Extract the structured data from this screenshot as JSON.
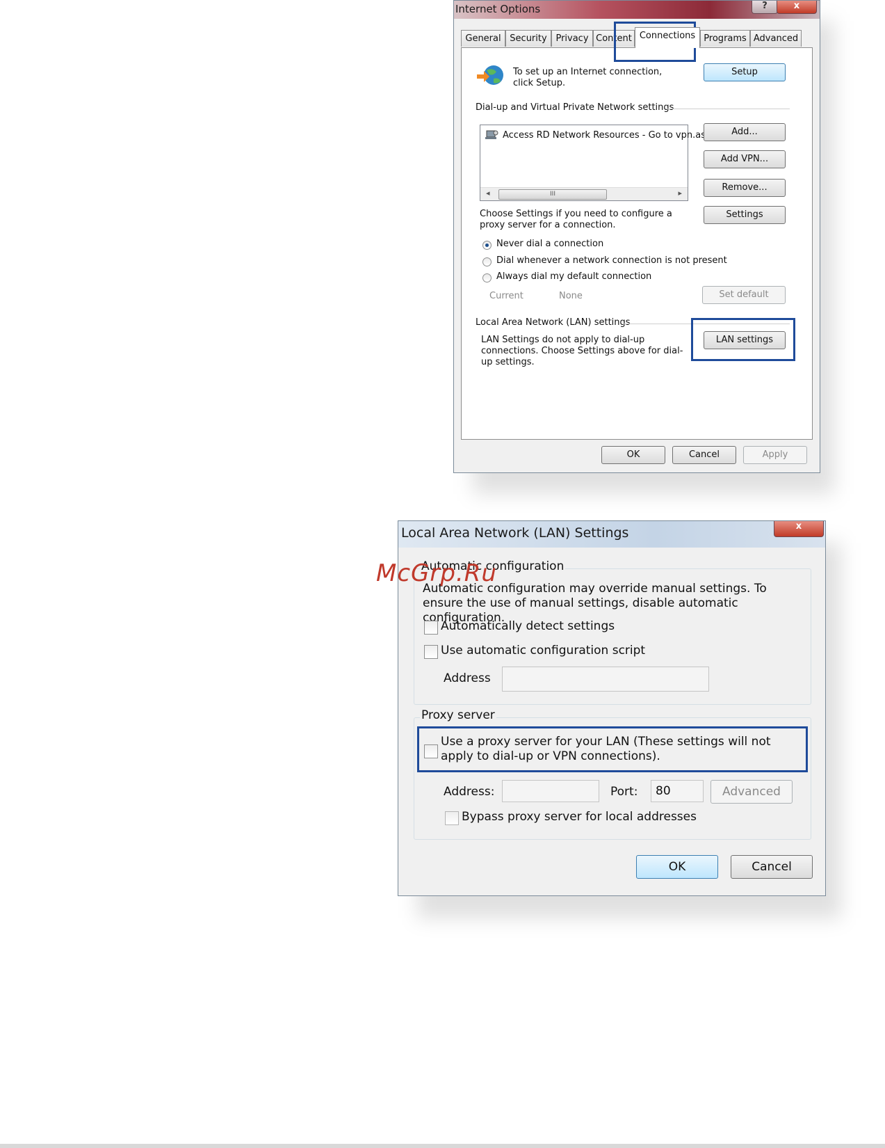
{
  "internet_options": {
    "title": "Internet Options",
    "help_glyph": "?",
    "close_glyph": "x",
    "tabs": [
      "General",
      "Security",
      "Privacy",
      "Content",
      "Connections",
      "Programs",
      "Advanced"
    ],
    "active_tab": "Connections",
    "setup_text": "To set up an Internet connection, click Setup.",
    "setup_button": "Setup",
    "dialup_heading": "Dial-up and Virtual Private Network settings",
    "connections": [
      "Access RD Network Resources - Go to vpn.as"
    ],
    "scroll_thumb_glyph": "III",
    "scroll_left_glyph": "◂",
    "scroll_right_glyph": "▸",
    "add_button": "Add...",
    "add_vpn_button": "Add VPN...",
    "remove_button": "Remove...",
    "proxy_text": "Choose Settings if you need to configure a proxy server for a connection.",
    "settings_button": "Settings",
    "radio_options": [
      "Never dial a connection",
      "Dial whenever a network connection is not present",
      "Always dial my default connection"
    ],
    "selected_radio": 0,
    "current_label": "Current",
    "current_value": "None",
    "set_default_button": "Set default",
    "lan_heading": "Local Area Network (LAN) settings",
    "lan_text": "LAN Settings do not apply to dial-up connections. Choose Settings above for dial-up settings.",
    "lan_settings_button": "LAN settings",
    "ok_button": "OK",
    "cancel_button": "Cancel",
    "apply_button": "Apply"
  },
  "lan_dialog": {
    "title": "Local Area Network (LAN) Settings",
    "close_glyph": "x",
    "auto_config_legend": "Automatic configuration",
    "auto_config_text": "Automatic configuration may override manual settings.  To ensure the use of manual settings, disable automatic configuration.",
    "auto_detect_label": "Automatically detect settings",
    "auto_script_label": "Use automatic configuration script",
    "script_address_label": "Address",
    "proxy_legend": "Proxy server",
    "use_proxy_label": "Use a proxy server for your LAN (These settings will not apply to dial-up or VPN connections).",
    "proxy_address_label": "Address:",
    "port_label": "Port:",
    "port_value": "80",
    "advanced_button": "Advanced",
    "bypass_label": "Bypass proxy server for local addresses",
    "ok_button": "OK",
    "cancel_button": "Cancel"
  },
  "watermark": "McGrp.Ru",
  "colors": {
    "highlight_box": "#1f4b9a",
    "watermark": "#c0392b"
  }
}
